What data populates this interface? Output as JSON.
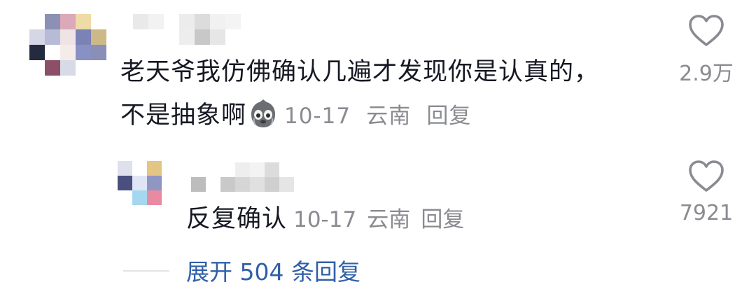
{
  "comments": [
    {
      "text_line1": "老天爷我仿佛确认几遍才发现你是认真的，",
      "text_line2": "不是抽象啊",
      "emoji": "crying-face-icon",
      "date": "10-17",
      "location": "云南",
      "reply_label": "回复",
      "likes": "2.9万"
    },
    {
      "text": "反复确认",
      "date": "10-17",
      "location": "云南",
      "reply_label": "回复",
      "likes": "7921"
    }
  ],
  "expand_replies": "展开 504 条回复",
  "colors": {
    "text": "#161823",
    "meta": "#8a8b91",
    "link": "#2f5fa8",
    "heart_stroke": "#8a8b91"
  }
}
